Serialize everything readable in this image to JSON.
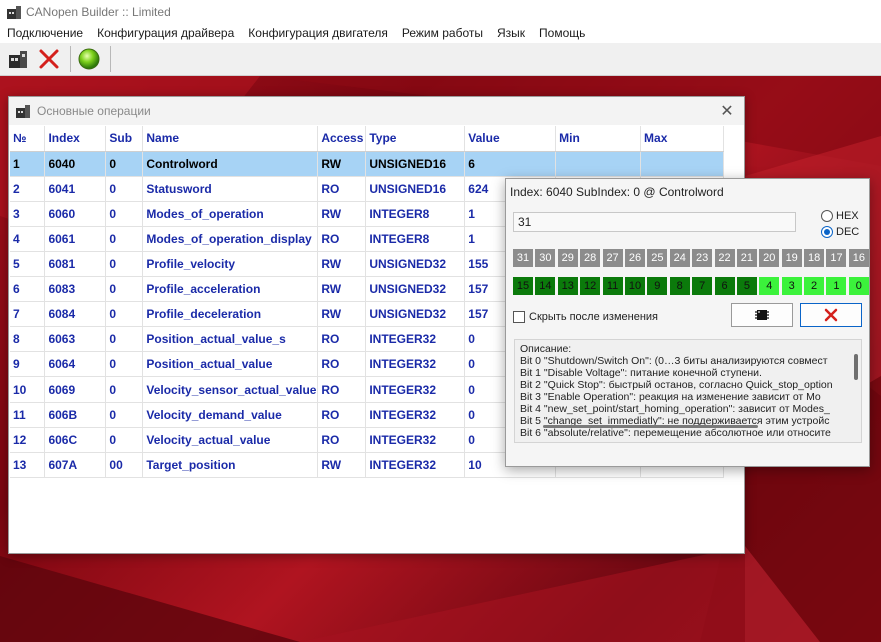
{
  "app": {
    "title": "CANopen Builder :: Limited"
  },
  "menu": [
    "Подключение",
    "Конфигурация драйвера",
    "Конфигурация двигателя",
    "Режим работы",
    "Язык",
    "Помощь"
  ],
  "toolbar": {
    "icons": [
      "connect-icon",
      "disconnect-icon",
      "status-led-icon"
    ]
  },
  "ops_window": {
    "title": "Основные операции",
    "columns": [
      "№",
      "Index",
      "Sub",
      "Name",
      "Access",
      "Type",
      "Value",
      "Min",
      "Max"
    ],
    "rows": [
      [
        "1",
        "6040",
        "0",
        "Controlword",
        "RW",
        "UNSIGNED16",
        "6",
        "",
        ""
      ],
      [
        "2",
        "6041",
        "0",
        "Statusword",
        "RO",
        "UNSIGNED16",
        "624",
        "",
        ""
      ],
      [
        "3",
        "6060",
        "0",
        "Modes_of_operation",
        "RW",
        "INTEGER8",
        "1",
        "",
        ""
      ],
      [
        "4",
        "6061",
        "0",
        "Modes_of_operation_display",
        "RO",
        "INTEGER8",
        "1",
        "",
        ""
      ],
      [
        "5",
        "6081",
        "0",
        "Profile_velocity",
        "RW",
        "UNSIGNED32",
        "155",
        "",
        ""
      ],
      [
        "6",
        "6083",
        "0",
        "Profile_acceleration",
        "RW",
        "UNSIGNED32",
        "157",
        "",
        ""
      ],
      [
        "7",
        "6084",
        "0",
        "Profile_deceleration",
        "RW",
        "UNSIGNED32",
        "157",
        "",
        ""
      ],
      [
        "8",
        "6063",
        "0",
        "Position_actual_value_s",
        "RO",
        "INTEGER32",
        "0",
        "",
        ""
      ],
      [
        "9",
        "6064",
        "0",
        "Position_actual_value",
        "RO",
        "INTEGER32",
        "0",
        "",
        ""
      ],
      [
        "10",
        "6069",
        "0",
        "Velocity_sensor_actual_value",
        "RO",
        "INTEGER32",
        "0",
        "",
        ""
      ],
      [
        "11",
        "606B",
        "0",
        "Velocity_demand_value",
        "RO",
        "INTEGER32",
        "0",
        "",
        ""
      ],
      [
        "12",
        "606C",
        "0",
        "Velocity_actual_value",
        "RO",
        "INTEGER32",
        "0",
        "",
        ""
      ],
      [
        "13",
        "607A",
        "00",
        "Target_position",
        "RW",
        "INTEGER32",
        "10",
        "",
        ""
      ]
    ],
    "selected_row": 0
  },
  "bit_editor": {
    "title": "Index: 6040 SubIndex: 0 @ Controlword",
    "value": "31",
    "radio_hex": "HEX",
    "radio_dec": "DEC",
    "selected_radio": "DEC",
    "bit_labels": [
      "31",
      "30",
      "29",
      "28",
      "27",
      "26",
      "25",
      "24",
      "23",
      "22",
      "21",
      "20",
      "19",
      "18",
      "17",
      "16"
    ],
    "bit_values": [
      "15",
      "14",
      "13",
      "12",
      "11",
      "10",
      "9",
      "8",
      "7",
      "6",
      "5",
      "4",
      "3",
      "2",
      "1",
      "0"
    ],
    "bit_states": [
      0,
      0,
      0,
      0,
      0,
      0,
      0,
      0,
      0,
      0,
      0,
      1,
      1,
      1,
      1,
      1
    ],
    "colors": {
      "bit_off": "#0b7a0b",
      "bit_on": "#3bf23b",
      "header_bg": "#8c8c8c",
      "selected_row": "#a7d3f5",
      "grid_text": "#1a2aa8"
    },
    "hide_checkbox_label": "Скрыть после изменения",
    "description_lines": [
      "Описание:",
      "Bit 0 \"Shutdown/Switch On\": (0…3 биты анализируются совмест",
      "Bit 1 \"Disable Voltage\": питание конечной ступени.",
      "Bit 2 \"Quick Stop\": быстрый останов, согласно Quick_stop_option",
      "Bit 3 \"Enable Operation\": реакция на изменение зависит от Mo",
      "Bit 4 \"new_set_point/start_homing_operation\": зависит от Modes_",
      "Bit 5 \"change_set_immediatly\": не поддерживается этим устройс",
      "Bit 6 \"absolute/relative\": перемещение абсолютное или относите"
    ]
  }
}
